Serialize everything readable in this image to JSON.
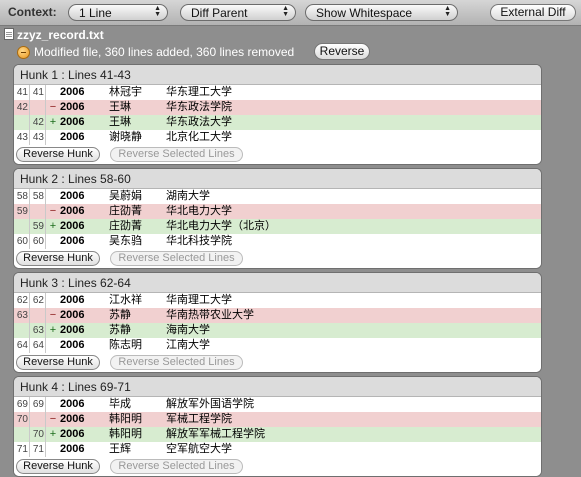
{
  "toolbar": {
    "context_label": "Context:",
    "context_value": "1 Line",
    "diff_parent": "Diff Parent",
    "whitespace": "Show Whitespace",
    "external_diff": "External Diff"
  },
  "file": {
    "name": "zzyz_record.txt",
    "status": "Modified file, 360 lines added, 360 lines removed",
    "reverse_label": "Reverse"
  },
  "hunk_buttons": {
    "reverse_hunk": "Reverse Hunk",
    "reverse_selected": "Reverse Selected Lines"
  },
  "hunks": [
    {
      "title": "Hunk 1 : Lines 41-43",
      "lines": [
        {
          "type": "ctx",
          "old": "41",
          "new": "41",
          "sign": "",
          "year": "2006",
          "name": "林冠宇",
          "school": "华东理工大学"
        },
        {
          "type": "rem",
          "old": "42",
          "new": "",
          "sign": "−",
          "year": "2006",
          "name": "王琳",
          "school": "华东政法学院"
        },
        {
          "type": "add",
          "old": "",
          "new": "42",
          "sign": "+",
          "year": "2006",
          "name": "王琳",
          "school": "华东政法大学"
        },
        {
          "type": "ctx",
          "old": "43",
          "new": "43",
          "sign": "",
          "year": "2006",
          "name": "谢晓静",
          "school": "北京化工大学"
        }
      ]
    },
    {
      "title": "Hunk 2 : Lines 58-60",
      "lines": [
        {
          "type": "ctx",
          "old": "58",
          "new": "58",
          "sign": "",
          "year": "2006",
          "name": "吴蔚娟",
          "school": "湖南大学"
        },
        {
          "type": "rem",
          "old": "59",
          "new": "",
          "sign": "−",
          "year": "2006",
          "name": "庄劭菁",
          "school": "华北电力大学"
        },
        {
          "type": "add",
          "old": "",
          "new": "59",
          "sign": "+",
          "year": "2006",
          "name": "庄劭菁",
          "school": "华北电力大学（北京）"
        },
        {
          "type": "ctx",
          "old": "60",
          "new": "60",
          "sign": "",
          "year": "2006",
          "name": "吴东驺",
          "school": "华北科技学院"
        }
      ]
    },
    {
      "title": "Hunk 3 : Lines 62-64",
      "lines": [
        {
          "type": "ctx",
          "old": "62",
          "new": "62",
          "sign": "",
          "year": "2006",
          "name": "江水祥",
          "school": "华南理工大学"
        },
        {
          "type": "rem",
          "old": "63",
          "new": "",
          "sign": "−",
          "year": "2006",
          "name": "苏静",
          "school": "华南热带农业大学"
        },
        {
          "type": "add",
          "old": "",
          "new": "63",
          "sign": "+",
          "year": "2006",
          "name": "苏静",
          "school": "海南大学"
        },
        {
          "type": "ctx",
          "old": "64",
          "new": "64",
          "sign": "",
          "year": "2006",
          "name": "陈志明",
          "school": "江南大学"
        }
      ]
    },
    {
      "title": "Hunk 4 : Lines 69-71",
      "lines": [
        {
          "type": "ctx",
          "old": "69",
          "new": "69",
          "sign": "",
          "year": "2006",
          "name": "毕成",
          "school": "解放军外国语学院"
        },
        {
          "type": "rem",
          "old": "70",
          "new": "",
          "sign": "−",
          "year": "2006",
          "name": "韩阳明",
          "school": "军械工程学院"
        },
        {
          "type": "add",
          "old": "",
          "new": "70",
          "sign": "+",
          "year": "2006",
          "name": "韩阳明",
          "school": "解放军军械工程学院"
        },
        {
          "type": "ctx",
          "old": "71",
          "new": "71",
          "sign": "",
          "year": "2006",
          "name": "王辉",
          "school": "空军航空大学"
        }
      ]
    }
  ]
}
